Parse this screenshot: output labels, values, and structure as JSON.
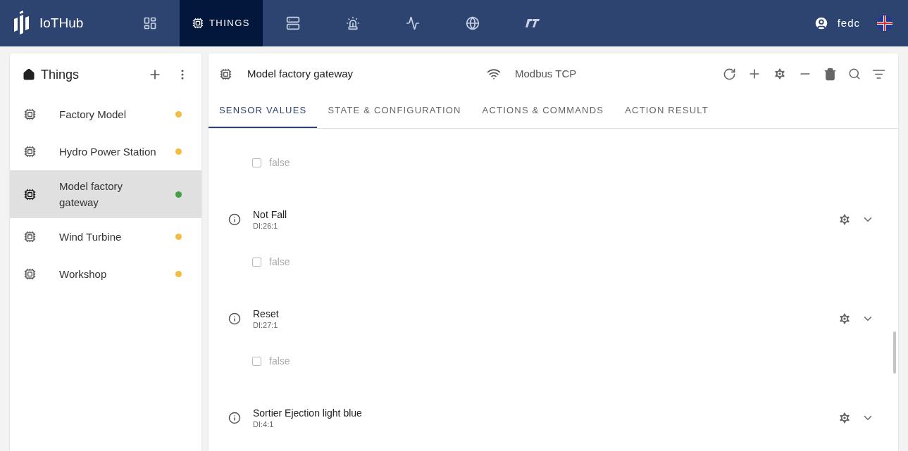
{
  "app": {
    "name": "IoTHub"
  },
  "nav": [
    {
      "kind": "dashboard",
      "selected": false
    },
    {
      "kind": "things",
      "label": "THINGS",
      "selected": true
    },
    {
      "kind": "storage",
      "selected": false
    },
    {
      "kind": "alarm",
      "selected": false
    },
    {
      "kind": "chart",
      "selected": false
    },
    {
      "kind": "globe",
      "selected": false
    },
    {
      "kind": "logo",
      "selected": false
    }
  ],
  "user": {
    "name": "fedc"
  },
  "sidebar": {
    "title": "Things",
    "items": [
      {
        "label": "Factory Model",
        "selected": false,
        "color": "#f4bc42"
      },
      {
        "label": "Hydro Power Station",
        "selected": false,
        "color": "#f4bc42"
      },
      {
        "label": "Model factory gateway",
        "selected": true,
        "color": "#43a047"
      },
      {
        "label": "Wind Turbine",
        "selected": false,
        "color": "#f4bc42"
      },
      {
        "label": "Workshop",
        "selected": false,
        "color": "#f4bc42"
      }
    ]
  },
  "detail": {
    "title": "Model factory gateway",
    "protocol": "Modbus TCP",
    "tabs": [
      {
        "label": "SENSOR VALUES",
        "selected": true
      },
      {
        "label": "STATE & CONFIGURATION",
        "selected": false
      },
      {
        "label": "ACTIONS & COMMANDS",
        "selected": false
      },
      {
        "label": "ACTION RESULT",
        "selected": false
      }
    ],
    "sensors": [
      {
        "value": {
          "label": "false",
          "checked": false
        }
      },
      {
        "name": "Not Fall",
        "address": "DI:26:1",
        "value": {
          "label": "false",
          "checked": false
        }
      },
      {
        "name": "Reset",
        "address": "DI:27:1",
        "value": {
          "label": "false",
          "checked": false
        }
      },
      {
        "name": "Sortier Ejection light blue",
        "address": "DI:4:1"
      }
    ]
  }
}
